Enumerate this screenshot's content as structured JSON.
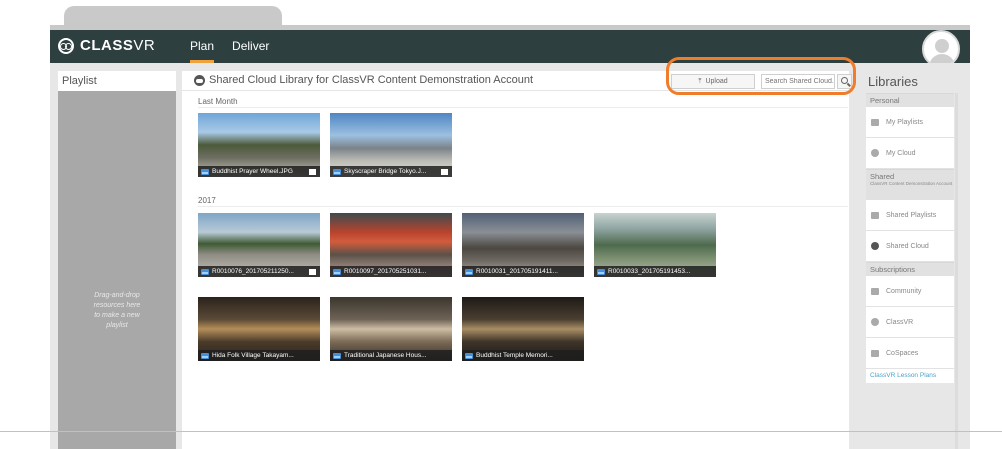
{
  "header": {
    "brand_bold": "CLASS",
    "brand_light": "VR",
    "nav": [
      {
        "label": "Plan"
      },
      {
        "label": "Deliver"
      }
    ]
  },
  "playlist": {
    "title": "Playlist",
    "hint_lines": [
      "Drag-and-drop",
      "resources here",
      "to make a new",
      "playlist"
    ]
  },
  "library": {
    "title": "Shared Cloud Library for ClassVR Content Demonstration Account",
    "upload_label": "Upload",
    "search_placeholder": "Search Shared Cloud...",
    "sections": [
      {
        "label": "Last Month",
        "items": [
          {
            "caption": "Buddhist Prayer Wheel.JPG"
          },
          {
            "caption": "Skyscraper Bridge Tokyo.J..."
          }
        ]
      },
      {
        "label": "2017",
        "items": [
          {
            "caption": "R0010076_201705211250..."
          },
          {
            "caption": "R0010097_201705251031..."
          },
          {
            "caption": "R0010031_201705191411..."
          },
          {
            "caption": "R0010033_201705191453..."
          },
          {
            "caption": "Hida Folk Village Takayam..."
          },
          {
            "caption": "Traditional Japanese Hous..."
          },
          {
            "caption": "Buddhist Temple Memori..."
          }
        ]
      }
    ]
  },
  "libraries": {
    "title": "Libraries",
    "personal_label": "Personal",
    "my_playlists": "My Playlists",
    "my_cloud": "My Cloud",
    "shared_label": "Shared",
    "shared_sub": "ClassVR Content Demonstration Account",
    "shared_playlists": "Shared Playlists",
    "shared_cloud": "Shared Cloud",
    "subscriptions_label": "Subscriptions",
    "community": "Community",
    "classvr": "ClassVR",
    "cospaces": "CoSpaces",
    "lesson_plans": "ClassVR Lesson Plans"
  },
  "colors": {
    "header_bg": "#2e3f40",
    "accent": "#f0a33a",
    "highlight_ring": "#ef7d2b",
    "link": "#4aa3c9"
  }
}
